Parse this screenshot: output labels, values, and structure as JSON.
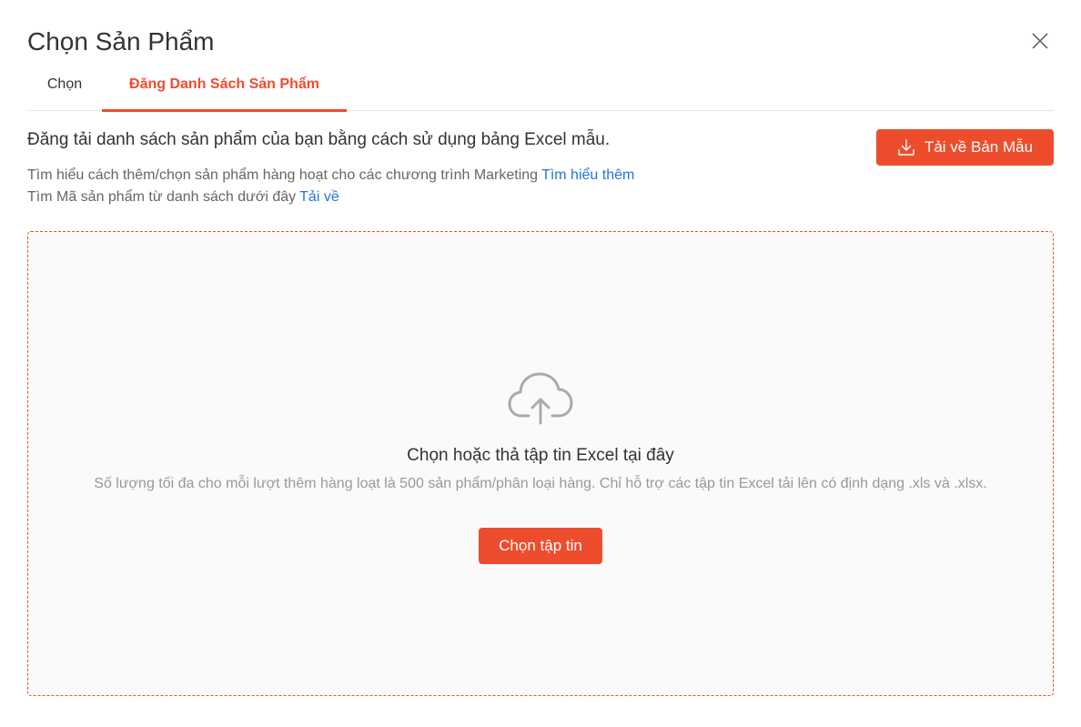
{
  "modal": {
    "title": "Chọn Sản Phẩm"
  },
  "tabs": [
    {
      "label": "Chọn",
      "active": false
    },
    {
      "label": "Đăng Danh Sách Sản Phẩm",
      "active": true
    }
  ],
  "upload": {
    "description": "Đăng tải danh sách sản phẩm của bạn bằng cách sử dụng bảng Excel mẫu.",
    "download_template_label": "Tải về Bản Mẫu",
    "hint_1": {
      "text": "Tìm hiểu cách thêm/chọn sản phẩm hàng hoạt cho các chương trình Marketing",
      "link": "Tìm hiểu thêm"
    },
    "hint_2": {
      "text": "Tìm Mã sản phẩm từ danh sách dưới đây",
      "link": "Tải về"
    },
    "dropzone": {
      "title": "Chọn hoặc thả tập tin Excel tại đây",
      "note": "Số lượng tối đa cho mỗi lượt thêm hàng loạt là 500 sản phẩm/phân loại hàng. Chỉ hỗ trợ các tập tin Excel tải lên có định dạng .xls và .xlsx.",
      "button_label": "Chọn tập tin"
    }
  },
  "icons": {
    "close": "close-icon",
    "download": "download-icon",
    "cloud_upload": "cloud-upload-icon"
  },
  "colors": {
    "accent": "#ee4d2d",
    "link": "#2673dd",
    "dashed_border": "#ee4d2d"
  }
}
